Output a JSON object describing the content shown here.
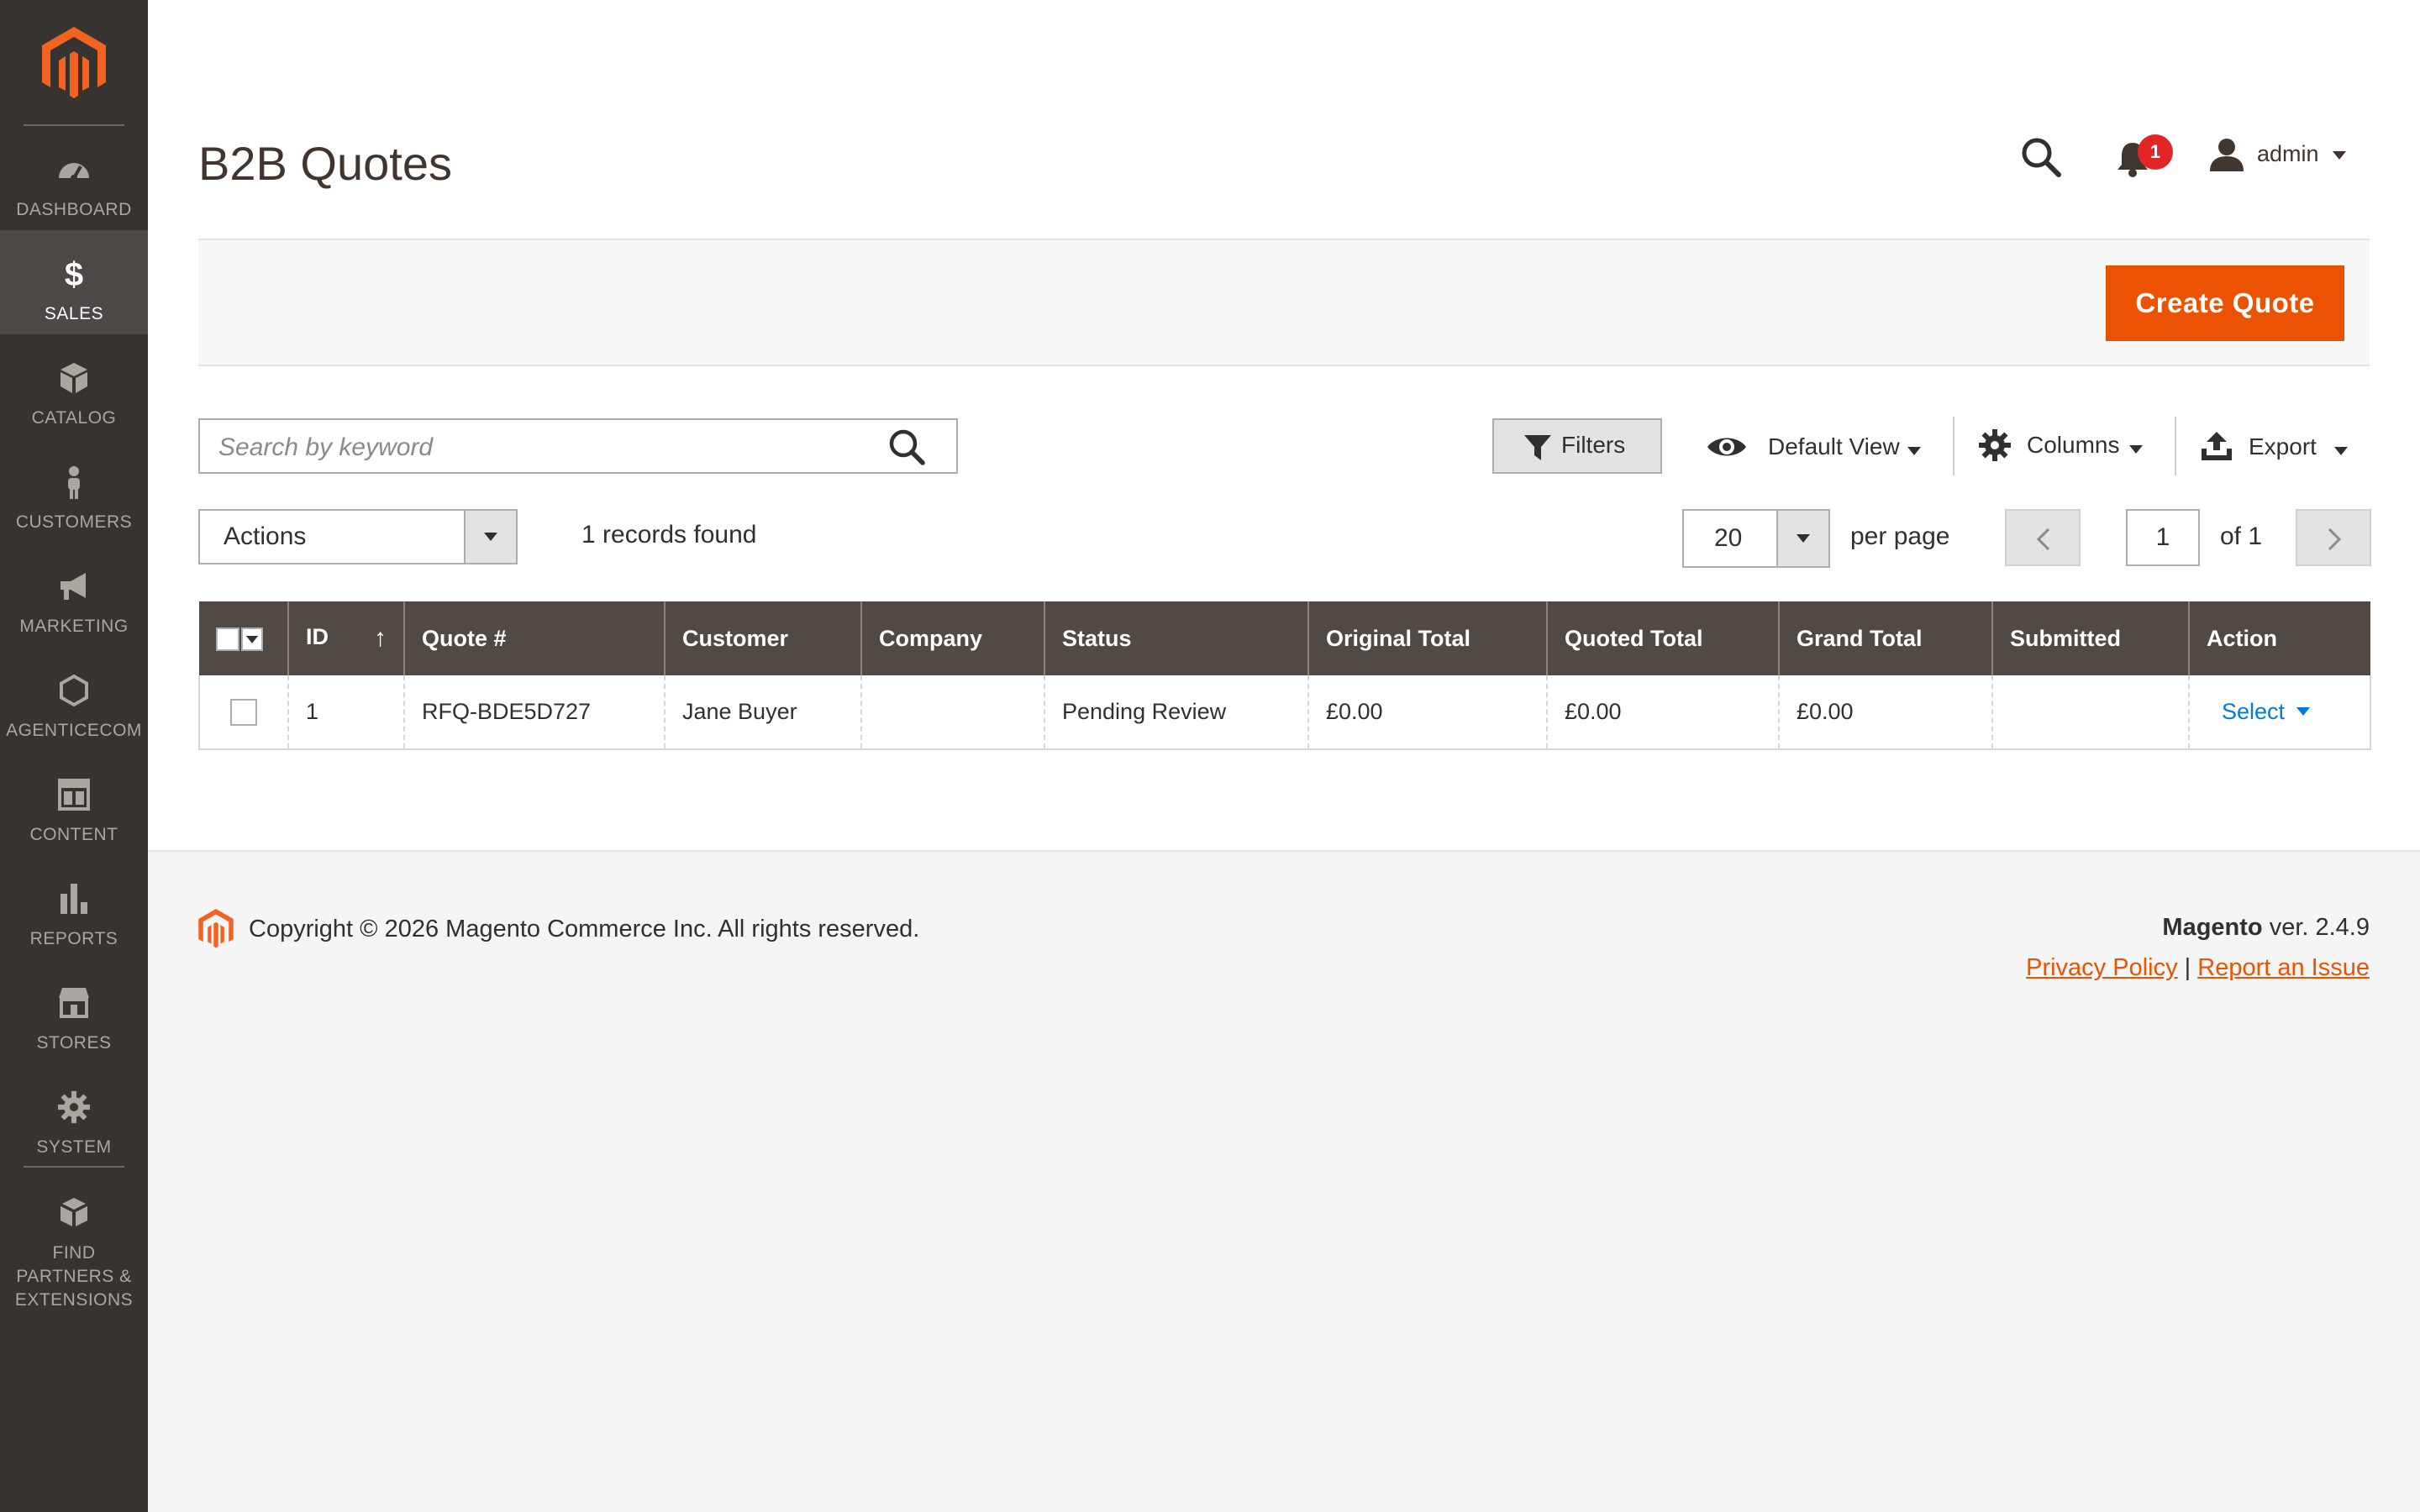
{
  "sidebar": {
    "items": [
      {
        "label": "Dashboard",
        "icon": "dashboard-icon"
      },
      {
        "label": "Sales",
        "icon": "dollar-icon"
      },
      {
        "label": "Catalog",
        "icon": "box-icon"
      },
      {
        "label": "Customers",
        "icon": "person-icon"
      },
      {
        "label": "Marketing",
        "icon": "megaphone-icon"
      },
      {
        "label": "AgenticeCom",
        "icon": "hexagon-icon"
      },
      {
        "label": "Content",
        "icon": "layout-icon"
      },
      {
        "label": "Reports",
        "icon": "bar-chart-icon"
      },
      {
        "label": "Stores",
        "icon": "store-icon"
      },
      {
        "label": "System",
        "icon": "gear-icon"
      },
      {
        "label": "Find Partners & Extensions",
        "icon": "cubes-icon"
      }
    ],
    "active": "Sales"
  },
  "header": {
    "title": "B2B Quotes",
    "notification_count": "1",
    "user": "admin"
  },
  "page_actions": {
    "create_label": "Create Quote"
  },
  "grid_controls": {
    "search_placeholder": "Search by keyword",
    "filters_label": "Filters",
    "view_label": "Default View",
    "columns_label": "Columns",
    "export_label": "Export",
    "actions_label": "Actions",
    "records_found": "1 records found",
    "per_page_value": "20",
    "per_page_label": "per page",
    "page_value": "1",
    "page_of": "of 1"
  },
  "table": {
    "columns": [
      "ID",
      "Quote #",
      "Customer",
      "Company",
      "Status",
      "Original Total",
      "Quoted Total",
      "Grand Total",
      "Submitted",
      "Action"
    ],
    "sort_indicator": "↑",
    "rows": [
      {
        "id": "1",
        "quote": "RFQ-BDE5D727",
        "customer": "Jane Buyer",
        "company": "",
        "status": "Pending Review",
        "original_total": "£0.00",
        "quoted_total": "£0.00",
        "grand_total": "£0.00",
        "submitted": "",
        "action": "Select"
      }
    ]
  },
  "footer": {
    "copyright": "Copyright © 2026 Magento Commerce Inc. All rights reserved.",
    "brand": "Magento",
    "version": " ver. 2.4.9",
    "privacy": "Privacy Policy",
    "separator": " | ",
    "report": "Report an Issue"
  },
  "colors": {
    "accent": "#eb5202",
    "sidebar": "#373330",
    "table_header": "#514943",
    "link": "#007bdb"
  }
}
